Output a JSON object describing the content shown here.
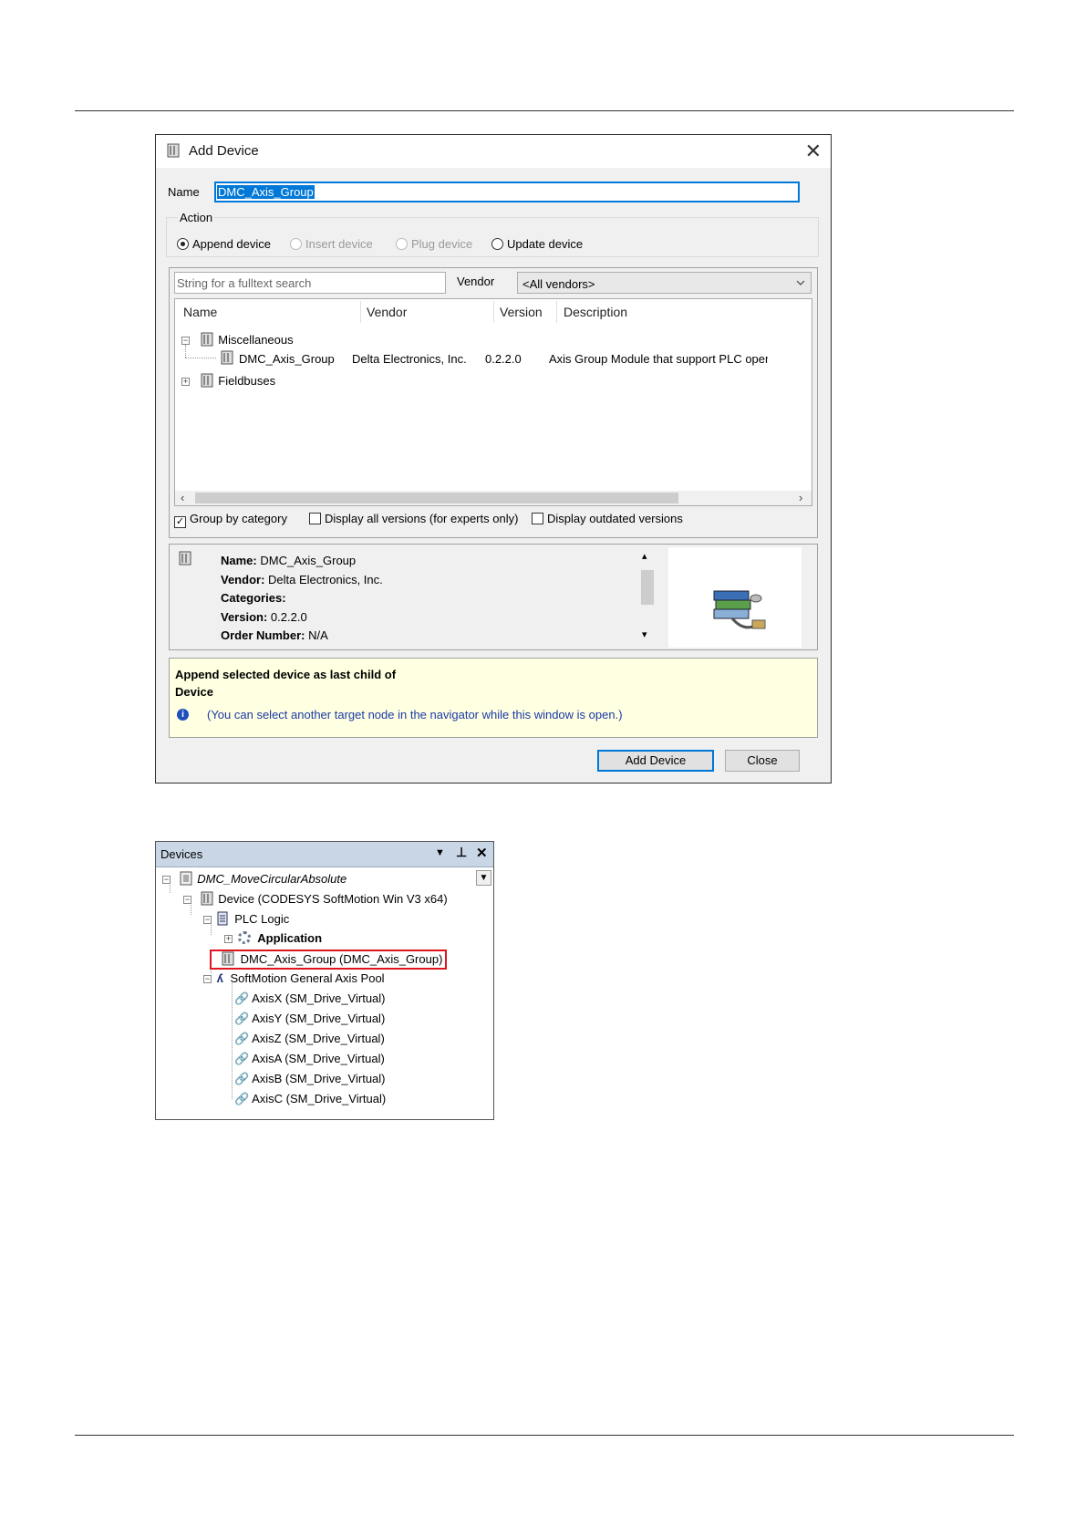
{
  "dialog": {
    "title": "Add Device",
    "name_label": "Name",
    "name_value": "DMC_Axis_Group",
    "action_label": "Action",
    "actions": [
      {
        "label": "Append device",
        "state": "selected"
      },
      {
        "label": "Insert device",
        "state": "disabled"
      },
      {
        "label": "Plug device",
        "state": "disabled"
      },
      {
        "label": "Update device",
        "state": "enabled"
      }
    ],
    "search_placeholder": "String for a fulltext search",
    "vendor_label": "Vendor",
    "vendor_value": "<All vendors>",
    "columns": [
      "Name",
      "Vendor",
      "Version",
      "Description"
    ],
    "tree": [
      {
        "name": "Miscellaneous",
        "toggle": "−"
      },
      {
        "name": "DMC_Axis_Group",
        "vendor": "Delta Electronics, Inc.",
        "version": "0.2.2.0",
        "description": "Axis Group Module that support PLC open pa"
      },
      {
        "name": "Fieldbuses",
        "toggle": "+"
      }
    ],
    "options": [
      {
        "label": "Group by category",
        "checked": true
      },
      {
        "label": "Display all versions (for experts only)",
        "checked": false
      },
      {
        "label": "Display outdated versions",
        "checked": false
      }
    ],
    "info": {
      "name_key": "Name:",
      "name_val": "DMC_Axis_Group",
      "vendor_key": "Vendor:",
      "vendor_val": "Delta Electronics, Inc.",
      "categories_key": "Categories:",
      "version_key": "Version:",
      "version_val": "0.2.2.0",
      "order_key": "Order Number:",
      "order_val": "N/A"
    },
    "hint_line1": "Append selected device as last child of",
    "hint_line2": "Device",
    "hint_note": "(You can select another target node in the navigator while this window is open.)",
    "add_button": "Add Device",
    "close_button": "Close",
    "colors": {
      "hint_bg": "#ffffe1",
      "accent": "#0078d7",
      "note_text": "#1a3aa8"
    }
  },
  "devices": {
    "title": "Devices",
    "items": [
      {
        "label": "DMC_MoveCircularAbsolute"
      },
      {
        "label": "Device (CODESYS SoftMotion Win V3 x64)"
      },
      {
        "label": "PLC Logic"
      },
      {
        "label": "Application"
      },
      {
        "label": "DMC_Axis_Group (DMC_Axis_Group)"
      },
      {
        "label": "SoftMotion General Axis Pool"
      },
      {
        "label": "AxisX (SM_Drive_Virtual)"
      },
      {
        "label": "AxisY (SM_Drive_Virtual)"
      },
      {
        "label": "AxisZ (SM_Drive_Virtual)"
      },
      {
        "label": "AxisA (SM_Drive_Virtual)"
      },
      {
        "label": "AxisB (SM_Drive_Virtual)"
      },
      {
        "label": "AxisC (SM_Drive_Virtual)"
      }
    ],
    "highlight_color": "#e0141e"
  }
}
